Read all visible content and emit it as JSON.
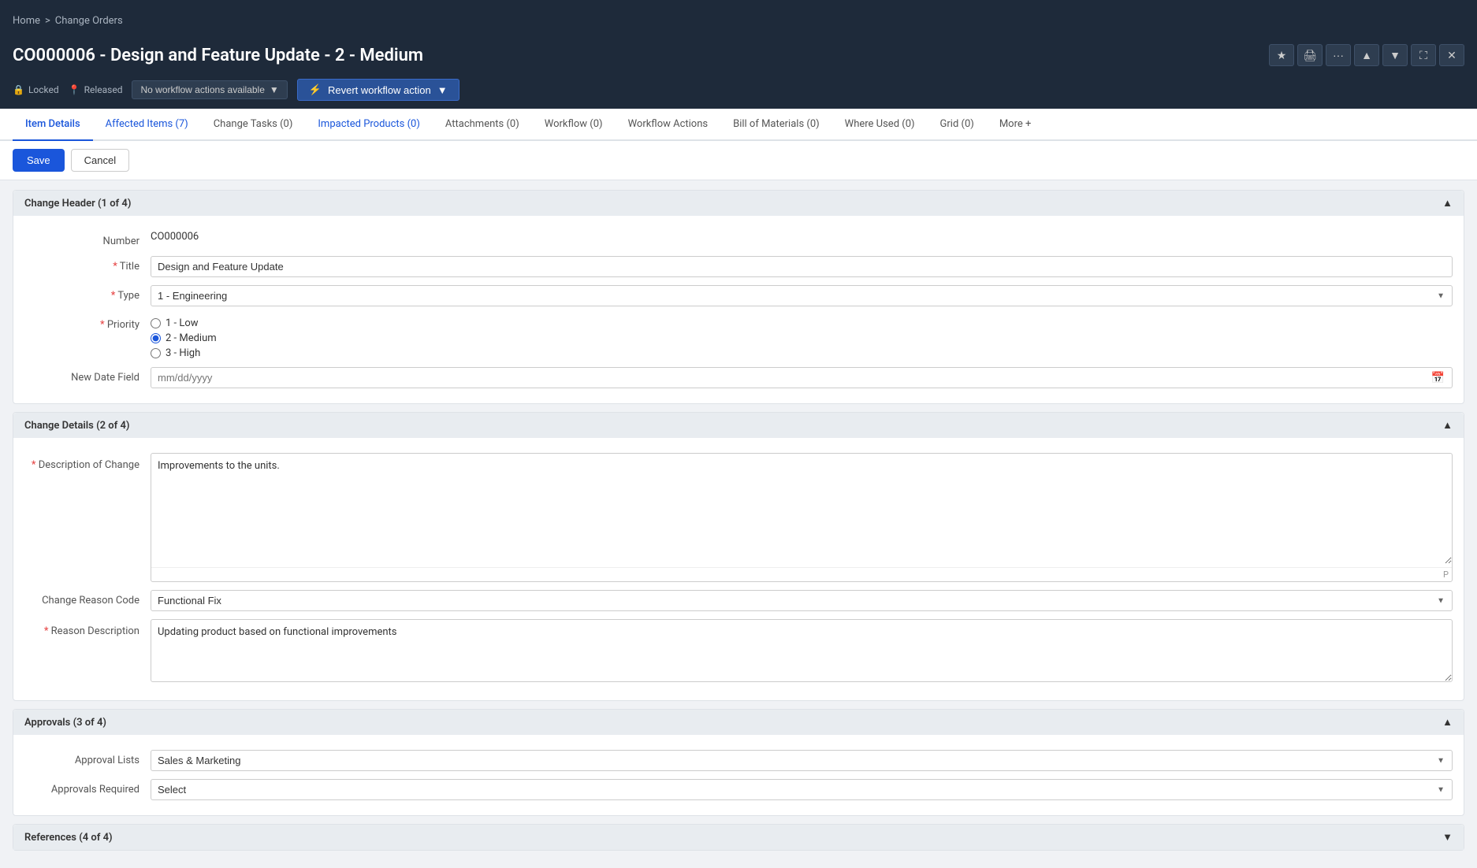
{
  "breadcrumb": {
    "home": "Home",
    "separator": ">",
    "current": "Change Orders"
  },
  "page": {
    "title": "CO000006 - Design and Feature Update - 2 - Medium"
  },
  "title_actions": {
    "star": "★",
    "print": "🖨",
    "more": "···",
    "nav_up": "▲",
    "nav_down": "▼",
    "expand": "⛶",
    "close": "✕"
  },
  "workflow": {
    "locked_label": "Locked",
    "released_label": "Released",
    "no_workflow_label": "No workflow actions available",
    "revert_label": "Revert workflow action"
  },
  "tabs": [
    {
      "id": "item-details",
      "label": "Item Details",
      "active": true,
      "count": null
    },
    {
      "id": "affected-items",
      "label": "Affected Items (7)",
      "active": false,
      "count": 7
    },
    {
      "id": "change-tasks",
      "label": "Change Tasks (0)",
      "active": false,
      "count": 0
    },
    {
      "id": "impacted-products",
      "label": "Impacted Products (0)",
      "active": false,
      "count": 0
    },
    {
      "id": "attachments",
      "label": "Attachments (0)",
      "active": false,
      "count": 0
    },
    {
      "id": "workflow",
      "label": "Workflow (0)",
      "active": false,
      "count": 0
    },
    {
      "id": "workflow-actions",
      "label": "Workflow Actions",
      "active": false,
      "count": null
    },
    {
      "id": "bill-of-materials",
      "label": "Bill of Materials (0)",
      "active": false,
      "count": 0
    },
    {
      "id": "where-used",
      "label": "Where Used (0)",
      "active": false,
      "count": 0
    },
    {
      "id": "grid",
      "label": "Grid (0)",
      "active": false,
      "count": 0
    },
    {
      "id": "more",
      "label": "More +",
      "active": false,
      "count": null
    }
  ],
  "actions": {
    "save_label": "Save",
    "cancel_label": "Cancel"
  },
  "sections": {
    "change_header": {
      "title": "Change Header (1 of 4)",
      "fields": {
        "number_label": "Number",
        "number_value": "CO000006",
        "title_label": "Title",
        "title_value": "Design and Feature Update",
        "type_label": "Type",
        "type_value": "1 - Engineering",
        "priority_label": "Priority",
        "priority_options": [
          {
            "value": "1",
            "label": "1 - Low",
            "checked": false
          },
          {
            "value": "2",
            "label": "2 - Medium",
            "checked": true
          },
          {
            "value": "3",
            "label": "3 - High",
            "checked": false
          }
        ],
        "new_date_label": "New Date Field",
        "new_date_placeholder": "mm/dd/yyyy"
      }
    },
    "change_details": {
      "title": "Change Details (2 of 4)",
      "fields": {
        "description_label": "Description of Change",
        "description_value": "Improvements to the units.",
        "description_footer": "P",
        "change_reason_label": "Change Reason Code",
        "change_reason_value": "Functional Fix",
        "reason_desc_label": "Reason Description",
        "reason_desc_value": "Updating product based on functional improvements"
      }
    },
    "approvals": {
      "title": "Approvals (3 of 4)",
      "fields": {
        "approval_lists_label": "Approval Lists",
        "approval_lists_value": "Sales & Marketing",
        "approvals_required_label": "Approvals Required",
        "approvals_required_placeholder": "Select"
      }
    },
    "references": {
      "title": "References (4 of 4)"
    }
  }
}
